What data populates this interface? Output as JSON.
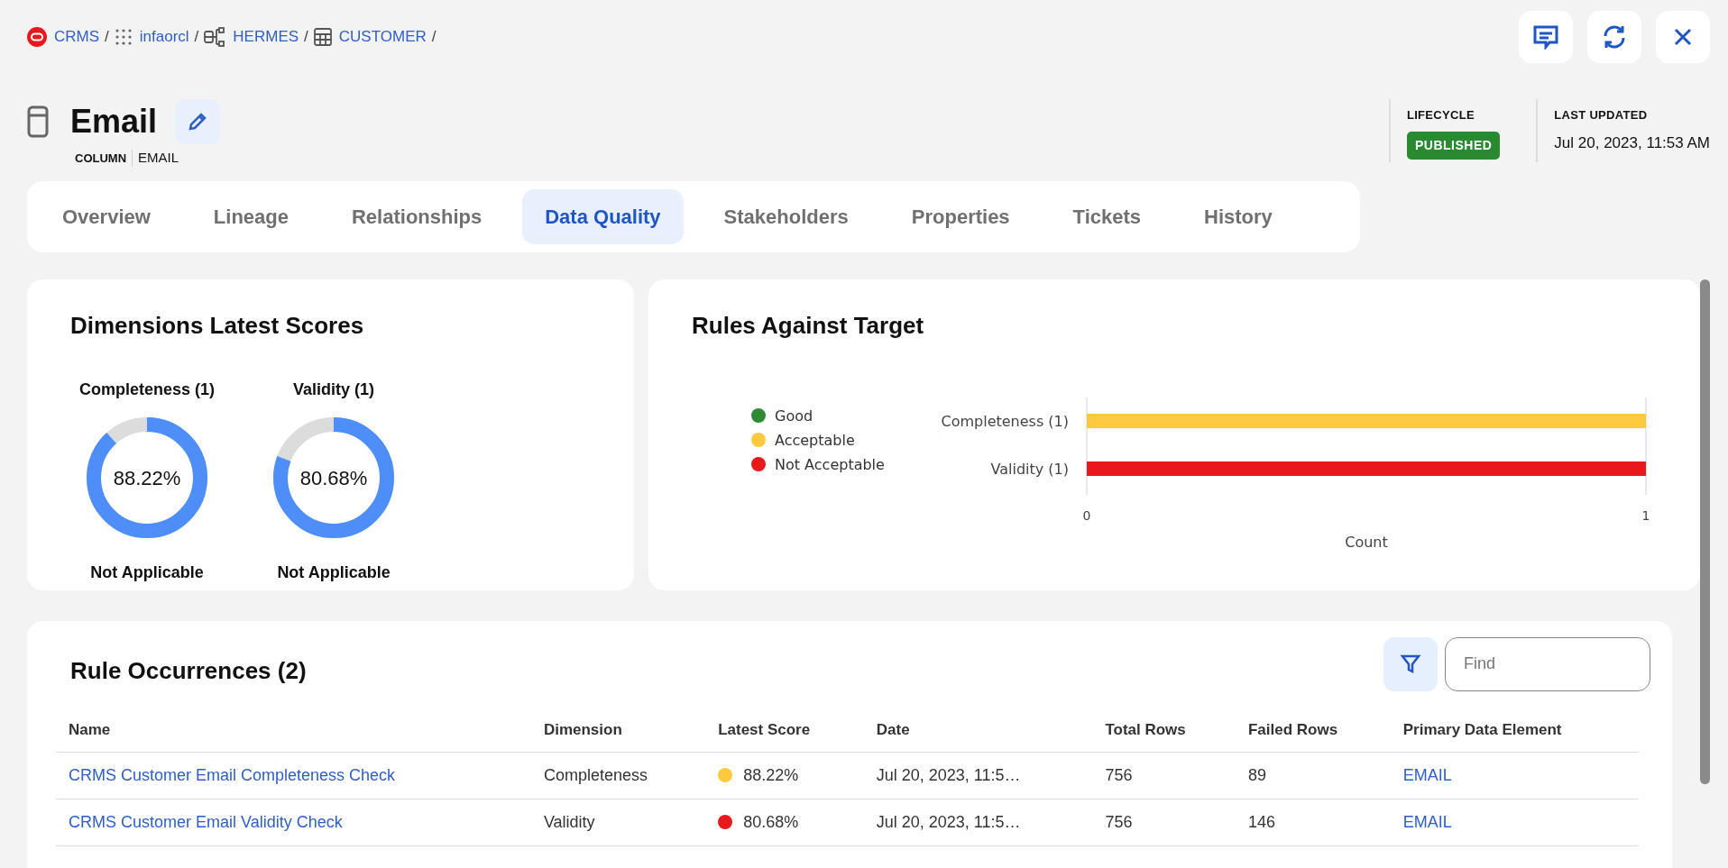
{
  "breadcrumb": [
    {
      "label": "CRMS",
      "kind": "oracle",
      "separator": "/"
    },
    {
      "label": "infaorcl",
      "kind": "grid",
      "separator": "/"
    },
    {
      "label": "HERMES",
      "kind": "schema",
      "separator": "/"
    },
    {
      "label": "CUSTOMER",
      "kind": "table",
      "separator": "/"
    }
  ],
  "asset": {
    "title": "Email",
    "type_label": "COLUMN",
    "type_value": "EMAIL"
  },
  "lifecycle": {
    "label": "LIFECYCLE",
    "value": "PUBLISHED"
  },
  "last_updated": {
    "label": "LAST UPDATED",
    "value": "Jul 20, 2023, 11:53 AM"
  },
  "tabs": [
    {
      "label": "Overview",
      "selected": false
    },
    {
      "label": "Lineage",
      "selected": false
    },
    {
      "label": "Relationships",
      "selected": false
    },
    {
      "label": "Data Quality",
      "selected": true
    },
    {
      "label": "Stakeholders",
      "selected": false
    },
    {
      "label": "Properties",
      "selected": false
    },
    {
      "label": "Tickets",
      "selected": false
    },
    {
      "label": "History",
      "selected": false
    }
  ],
  "dimensions": {
    "title": "Dimensions Latest Scores",
    "items": [
      {
        "label": "Completeness (1)",
        "score": "88.22%",
        "level": 0.8822,
        "status": "Not Applicable"
      },
      {
        "label": "Validity (1)",
        "score": "80.68%",
        "level": 0.8068,
        "status": "Not Applicable"
      }
    ]
  },
  "rules_against_target": {
    "title": "Rules Against Target",
    "chart_data": {
      "type": "bar",
      "orientation": "horizontal",
      "stacked": true,
      "legend": "left",
      "xlabel": "Count",
      "categories": [
        "Completeness (1)",
        "Validity (1)"
      ],
      "xticks": [
        0,
        1
      ],
      "xlim": [
        0,
        1
      ],
      "series": [
        {
          "name": "Good",
          "color": "#2e8b34",
          "values": [
            0,
            0
          ]
        },
        {
          "name": "Acceptable",
          "color": "#fdc93f",
          "values": [
            1,
            0
          ]
        },
        {
          "name": "Not Acceptable",
          "color": "#e8191c",
          "values": [
            0,
            1
          ]
        }
      ]
    }
  },
  "rule_occurrences": {
    "title": "Rule Occurrences (2)",
    "find_placeholder": "Find",
    "columns": [
      "Name",
      "Dimension",
      "Latest Score",
      "Date",
      "Total Rows",
      "Failed Rows",
      "Primary Data Element"
    ],
    "rows": [
      {
        "name": "CRMS Customer Email Completeness Check",
        "dimension": "Completeness",
        "latest_score": "88.22%",
        "color": "#fdc93f",
        "date": "Jul 20, 2023, 11:5…",
        "total_rows": "756",
        "failed_rows": "89",
        "primary_data_element": "EMAIL"
      },
      {
        "name": "CRMS Customer Email Validity Check",
        "dimension": "Validity",
        "latest_score": "80.68%",
        "color": "#e8191c",
        "date": "Jul 20, 2023, 11:5…",
        "total_rows": "756",
        "failed_rows": "146",
        "primary_data_element": "EMAIL"
      }
    ]
  }
}
